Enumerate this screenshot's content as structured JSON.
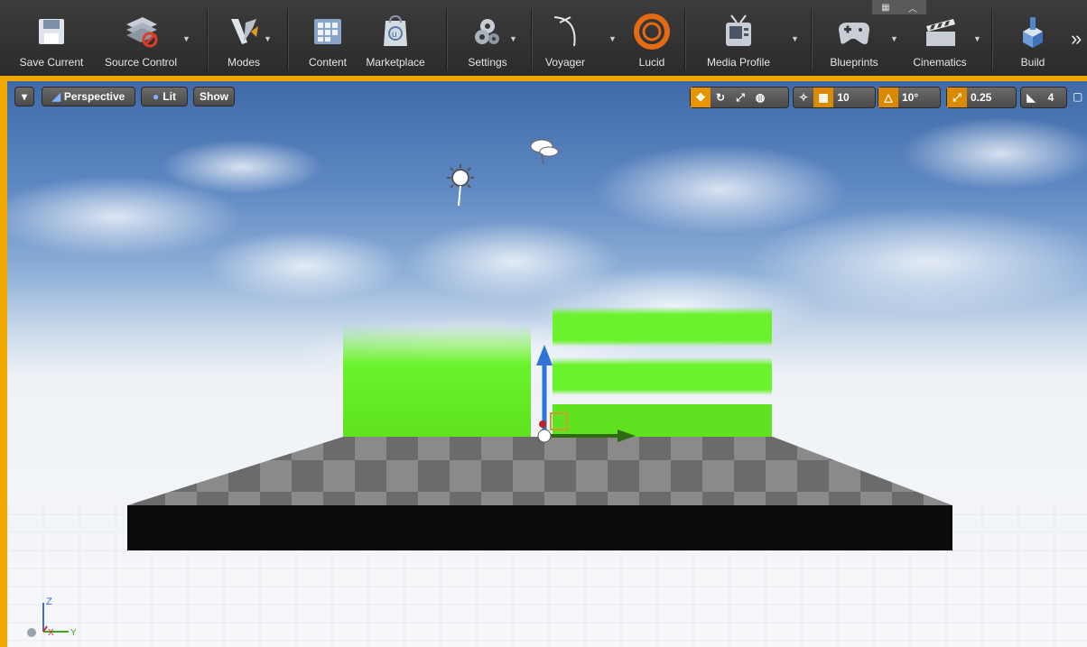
{
  "toolbar": {
    "items": [
      {
        "label": "Save Current",
        "icon": "save-icon"
      },
      {
        "label": "Source Control",
        "icon": "source-control-icon"
      },
      {
        "label": "Modes",
        "icon": "modes-icon"
      },
      {
        "label": "Content",
        "icon": "content-icon"
      },
      {
        "label": "Marketplace",
        "icon": "marketplace-icon"
      },
      {
        "label": "Settings",
        "icon": "settings-icon"
      },
      {
        "label": "Voyager",
        "icon": "voyager-icon"
      },
      {
        "label": "Lucid",
        "icon": "lucid-icon"
      },
      {
        "label": "Media Profile",
        "icon": "media-profile-icon"
      },
      {
        "label": "Blueprints",
        "icon": "blueprints-icon"
      },
      {
        "label": "Cinematics",
        "icon": "cinematics-icon"
      },
      {
        "label": "Build",
        "icon": "build-icon"
      }
    ],
    "overflow_label": "»",
    "colors": {
      "accent": "#f0a800",
      "bg": "#2f2f2f"
    }
  },
  "viewport": {
    "dropdown_label": "▾",
    "perspective_label": "Perspective",
    "lit_label": "Lit",
    "show_label": "Show",
    "grid_snap_value": "10",
    "rotation_snap_value": "10°",
    "scale_snap_value": "0.25",
    "camera_speed_value": "4",
    "axis_labels": {
      "z": "Z",
      "x": "X",
      "y": "Y"
    }
  }
}
